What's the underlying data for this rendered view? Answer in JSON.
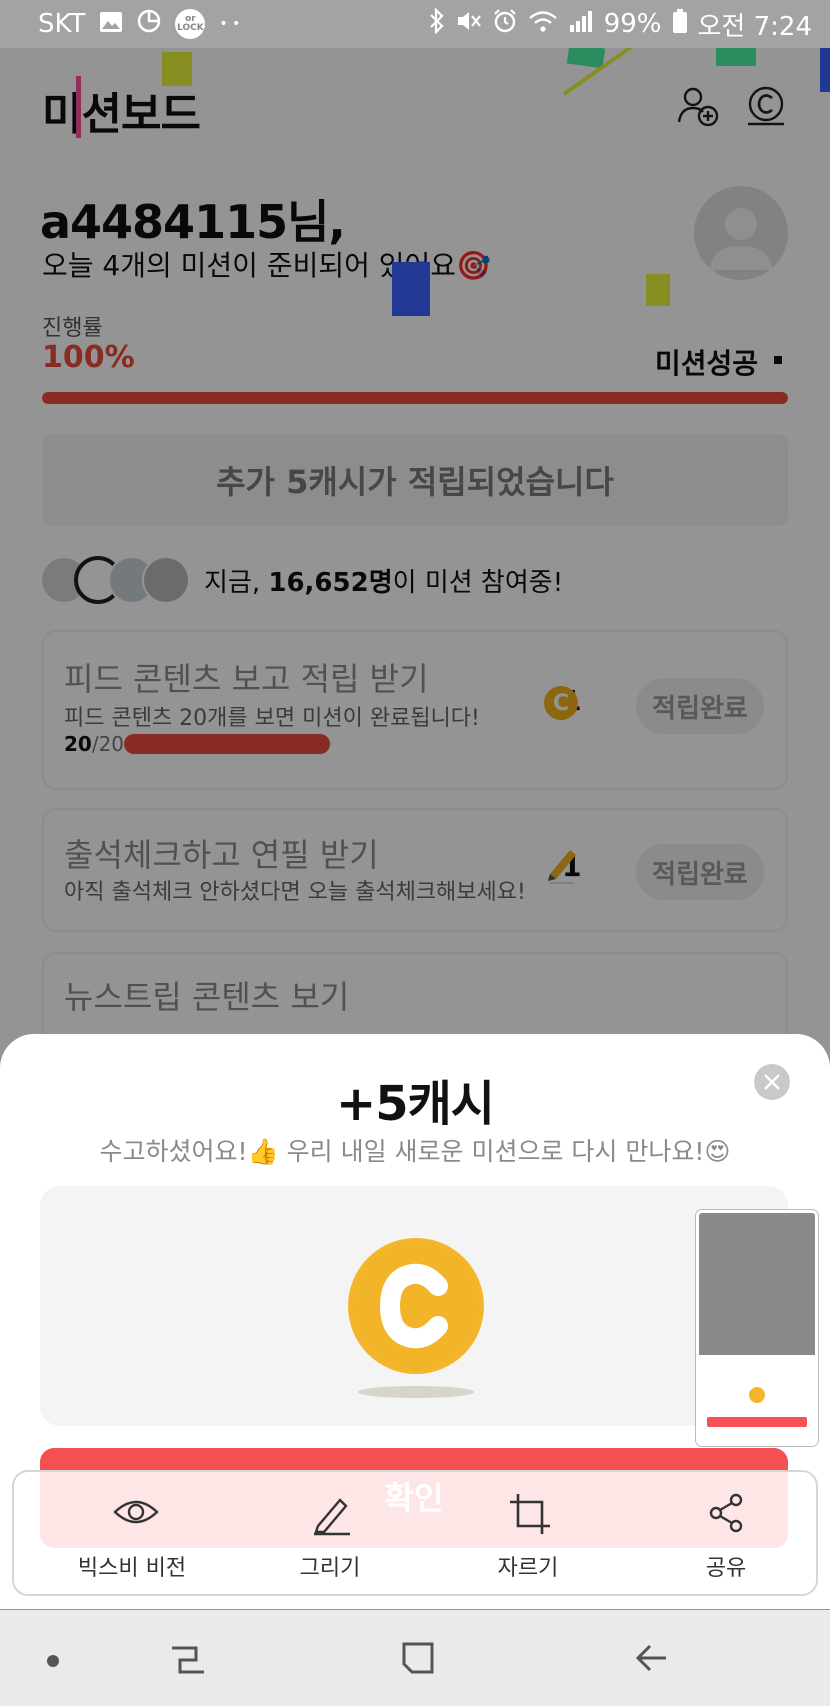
{
  "status_bar": {
    "carrier": "SKT",
    "lock_badge": "or LOCK",
    "dots": "• •",
    "battery": "99%",
    "time": "오전 7:24"
  },
  "header": {
    "title": "미션보드",
    "icons": [
      "add-friend-icon",
      "cash-icon"
    ]
  },
  "greeting": {
    "name": "a4484115님,",
    "subtitle": "오늘 4개의 미션이 준비되어 있어요🎯"
  },
  "progress": {
    "label": "진행률",
    "value": "100%",
    "fraction": 1.0,
    "status": "미션성공"
  },
  "bonus_banner": "추가 5캐시가 적립되었습니다",
  "participants": {
    "prefix": "지금, ",
    "count": "16,652명",
    "suffix": "이 미션 참여중!"
  },
  "missions": [
    {
      "title": "피드 콘텐츠 보고 적립 받기",
      "desc": "피드 콘텐츠 20개를 보면 미션이 완료됩니다!",
      "reward": "1",
      "reward_icon": "cash-coin-icon",
      "button": "적립완료",
      "count_done": "20",
      "count_total": "/20"
    },
    {
      "title": "출석체크하고 연필 받기",
      "desc": "아직 출석체크 안하셨다면 오늘 출석체크해보세요!",
      "reward": "1",
      "reward_icon": "pencil-icon",
      "button": "적립완료"
    },
    {
      "title": "뉴스트립 콘텐츠 보기"
    }
  ],
  "sheet": {
    "title": "+5캐시",
    "subtitle": "수고하셨어요!👍 우리 내일 새로운 미션으로 다시 만나요!😍",
    "coin_letter": "C",
    "confirm": "확인"
  },
  "toolbar": {
    "items": [
      {
        "label": "빅스비 비전",
        "icon": "eye-icon"
      },
      {
        "label": "그리기",
        "icon": "pen-icon"
      },
      {
        "label": "자르기",
        "icon": "crop-icon"
      },
      {
        "label": "공유",
        "icon": "share-icon"
      }
    ]
  },
  "colors": {
    "accent": "#e84a3d",
    "confirm": "#f55054",
    "coin": "#f3b62b"
  }
}
